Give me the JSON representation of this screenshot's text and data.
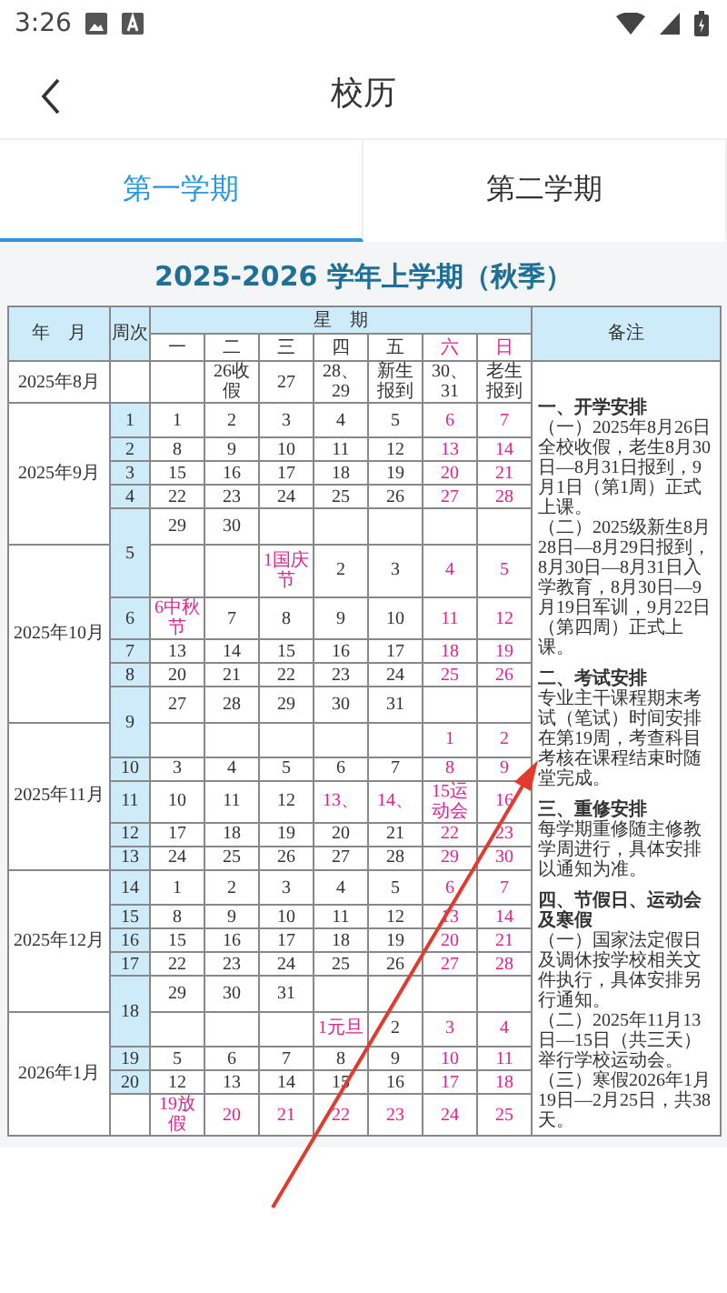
{
  "status_bar": {
    "time": "3:26"
  },
  "header": {
    "title": "校历"
  },
  "tabs": [
    {
      "label": "第一学期",
      "selected": true
    },
    {
      "label": "第二学期",
      "selected": false
    }
  ],
  "calendar": {
    "title": "2025-2026 学年上学期（秋季）",
    "columns": [
      "年　月",
      "周次",
      "星　期",
      "备注"
    ],
    "weekdays": [
      {
        "label": "一",
        "holiday": false
      },
      {
        "label": "二",
        "holiday": false
      },
      {
        "label": "三",
        "holiday": false
      },
      {
        "label": "四",
        "holiday": false
      },
      {
        "label": "五",
        "holiday": false
      },
      {
        "label": "六",
        "holiday": true
      },
      {
        "label": "日",
        "holiday": true
      }
    ],
    "rows": [
      {
        "kind": "no_week",
        "month": "2025年8月",
        "days": [
          {
            "kind": "blank"
          },
          {
            "kind": "day",
            "text": "26收假",
            "holiday": false
          },
          {
            "kind": "day",
            "text": "27",
            "holiday": false
          },
          {
            "kind": "day",
            "text": "28、29",
            "holiday": false
          },
          {
            "kind": "day",
            "text": "新生报到",
            "holiday": false
          },
          {
            "kind": "day",
            "text": "30、31",
            "holiday": false
          },
          {
            "kind": "day",
            "text": "老生报到",
            "holiday": false
          }
        ]
      },
      {
        "kind": "week_start",
        "month": "2025年9月",
        "week": "1",
        "days": [
          {
            "kind": "day",
            "text": "1",
            "holiday": false
          },
          {
            "kind": "day",
            "text": "2",
            "holiday": false
          },
          {
            "kind": "day",
            "text": "3",
            "holiday": false
          },
          {
            "kind": "day",
            "text": "4",
            "holiday": false
          },
          {
            "kind": "day",
            "text": "5",
            "holiday": false
          },
          {
            "kind": "day",
            "text": "6",
            "holiday": true
          },
          {
            "kind": "day",
            "text": "7",
            "holiday": true
          }
        ]
      },
      {
        "kind": "week_start",
        "week": "2",
        "days": [
          {
            "kind": "day",
            "text": "8",
            "holiday": false
          },
          {
            "kind": "day",
            "text": "9",
            "holiday": false
          },
          {
            "kind": "day",
            "text": "10",
            "holiday": false
          },
          {
            "kind": "day",
            "text": "11",
            "holiday": false
          },
          {
            "kind": "day",
            "text": "12",
            "holiday": false
          },
          {
            "kind": "day",
            "text": "13",
            "holiday": true
          },
          {
            "kind": "day",
            "text": "14",
            "holiday": true
          }
        ]
      },
      {
        "kind": "week_start",
        "week": "3",
        "days": [
          {
            "kind": "day",
            "text": "15",
            "holiday": false
          },
          {
            "kind": "day",
            "text": "16",
            "holiday": false
          },
          {
            "kind": "day",
            "text": "17",
            "holiday": false
          },
          {
            "kind": "day",
            "text": "18",
            "holiday": false
          },
          {
            "kind": "day",
            "text": "19",
            "holiday": false
          },
          {
            "kind": "day",
            "text": "20",
            "holiday": true
          },
          {
            "kind": "day",
            "text": "21",
            "holiday": true
          }
        ]
      },
      {
        "kind": "week_start",
        "week": "4",
        "days": [
          {
            "kind": "day",
            "text": "22",
            "holiday": false
          },
          {
            "kind": "day",
            "text": "23",
            "holiday": false
          },
          {
            "kind": "day",
            "text": "24",
            "holiday": false
          },
          {
            "kind": "day",
            "text": "25",
            "holiday": false
          },
          {
            "kind": "day",
            "text": "26",
            "holiday": false
          },
          {
            "kind": "day",
            "text": "27",
            "holiday": true
          },
          {
            "kind": "day",
            "text": "28",
            "holiday": true
          }
        ]
      },
      {
        "kind": "week_start",
        "week": "5",
        "days": [
          {
            "kind": "day",
            "text": "29",
            "holiday": false
          },
          {
            "kind": "day",
            "text": "30",
            "holiday": false
          },
          {
            "kind": "blank"
          },
          {
            "kind": "blank"
          },
          {
            "kind": "blank"
          },
          {
            "kind": "blank"
          },
          {
            "kind": "blank"
          }
        ]
      },
      {
        "kind": "week_continued",
        "month": "2025年10月",
        "days": [
          {
            "kind": "blank"
          },
          {
            "kind": "blank"
          },
          {
            "kind": "day",
            "text": "1国庆节",
            "holiday": true
          },
          {
            "kind": "day",
            "text": "2",
            "holiday": false
          },
          {
            "kind": "day",
            "text": "3",
            "holiday": false
          },
          {
            "kind": "day",
            "text": "4",
            "holiday": true
          },
          {
            "kind": "day",
            "text": "5",
            "holiday": true
          }
        ]
      },
      {
        "kind": "week_start",
        "week": "6",
        "days": [
          {
            "kind": "day",
            "text": "6中秋节",
            "holiday": true
          },
          {
            "kind": "day",
            "text": "7",
            "holiday": false
          },
          {
            "kind": "day",
            "text": "8",
            "holiday": false
          },
          {
            "kind": "day",
            "text": "9",
            "holiday": false
          },
          {
            "kind": "day",
            "text": "10",
            "holiday": false
          },
          {
            "kind": "day",
            "text": "11",
            "holiday": true
          },
          {
            "kind": "day",
            "text": "12",
            "holiday": true
          }
        ]
      },
      {
        "kind": "week_start",
        "week": "7",
        "days": [
          {
            "kind": "day",
            "text": "13",
            "holiday": false
          },
          {
            "kind": "day",
            "text": "14",
            "holiday": false
          },
          {
            "kind": "day",
            "text": "15",
            "holiday": false
          },
          {
            "kind": "day",
            "text": "16",
            "holiday": false
          },
          {
            "kind": "day",
            "text": "17",
            "holiday": false
          },
          {
            "kind": "day",
            "text": "18",
            "holiday": true
          },
          {
            "kind": "day",
            "text": "19",
            "holiday": true
          }
        ]
      },
      {
        "kind": "week_start",
        "week": "8",
        "days": [
          {
            "kind": "day",
            "text": "20",
            "holiday": false
          },
          {
            "kind": "day",
            "text": "21",
            "holiday": false
          },
          {
            "kind": "day",
            "text": "22",
            "holiday": false
          },
          {
            "kind": "day",
            "text": "23",
            "holiday": false
          },
          {
            "kind": "day",
            "text": "24",
            "holiday": false
          },
          {
            "kind": "day",
            "text": "25",
            "holiday": true
          },
          {
            "kind": "day",
            "text": "26",
            "holiday": true
          }
        ]
      },
      {
        "kind": "week_start",
        "week": "9",
        "days": [
          {
            "kind": "day",
            "text": "27",
            "holiday": false
          },
          {
            "kind": "day",
            "text": "28",
            "holiday": false
          },
          {
            "kind": "day",
            "text": "29",
            "holiday": false
          },
          {
            "kind": "day",
            "text": "30",
            "holiday": false
          },
          {
            "kind": "day",
            "text": "31",
            "holiday": false
          },
          {
            "kind": "blank"
          },
          {
            "kind": "blank"
          }
        ]
      },
      {
        "kind": "week_continued",
        "month": "2025年11月",
        "days": [
          {
            "kind": "blank"
          },
          {
            "kind": "blank"
          },
          {
            "kind": "blank"
          },
          {
            "kind": "blank"
          },
          {
            "kind": "blank"
          },
          {
            "kind": "day",
            "text": "1",
            "holiday": true
          },
          {
            "kind": "day",
            "text": "2",
            "holiday": true
          }
        ]
      },
      {
        "kind": "week_start",
        "week": "10",
        "days": [
          {
            "kind": "day",
            "text": "3",
            "holiday": false
          },
          {
            "kind": "day",
            "text": "4",
            "holiday": false
          },
          {
            "kind": "day",
            "text": "5",
            "holiday": false
          },
          {
            "kind": "day",
            "text": "6",
            "holiday": false
          },
          {
            "kind": "day",
            "text": "7",
            "holiday": false
          },
          {
            "kind": "day",
            "text": "8",
            "holiday": true
          },
          {
            "kind": "day",
            "text": "9",
            "holiday": true
          }
        ]
      },
      {
        "kind": "week_start",
        "week": "11",
        "days": [
          {
            "kind": "day",
            "text": "10",
            "holiday": false
          },
          {
            "kind": "day",
            "text": "11",
            "holiday": false
          },
          {
            "kind": "day",
            "text": "12",
            "holiday": false
          },
          {
            "kind": "day",
            "text": "13、",
            "holiday": true
          },
          {
            "kind": "day",
            "text": "14、",
            "holiday": true
          },
          {
            "kind": "day",
            "text": "15运动会",
            "holiday": true
          },
          {
            "kind": "day",
            "text": "16",
            "holiday": true
          }
        ]
      },
      {
        "kind": "week_start",
        "week": "12",
        "days": [
          {
            "kind": "day",
            "text": "17",
            "holiday": false
          },
          {
            "kind": "day",
            "text": "18",
            "holiday": false
          },
          {
            "kind": "day",
            "text": "19",
            "holiday": false
          },
          {
            "kind": "day",
            "text": "20",
            "holiday": false
          },
          {
            "kind": "day",
            "text": "21",
            "holiday": false
          },
          {
            "kind": "day",
            "text": "22",
            "holiday": true
          },
          {
            "kind": "day",
            "text": "23",
            "holiday": true
          }
        ]
      },
      {
        "kind": "week_start",
        "week": "13",
        "days": [
          {
            "kind": "day",
            "text": "24",
            "holiday": false
          },
          {
            "kind": "day",
            "text": "25",
            "holiday": false
          },
          {
            "kind": "day",
            "text": "26",
            "holiday": false
          },
          {
            "kind": "day",
            "text": "27",
            "holiday": false
          },
          {
            "kind": "day",
            "text": "28",
            "holiday": false
          },
          {
            "kind": "day",
            "text": "29",
            "holiday": true
          },
          {
            "kind": "day",
            "text": "30",
            "holiday": true
          }
        ]
      },
      {
        "kind": "week_start",
        "month": "2025年12月",
        "week": "14",
        "days": [
          {
            "kind": "day",
            "text": "1",
            "holiday": false
          },
          {
            "kind": "day",
            "text": "2",
            "holiday": false
          },
          {
            "kind": "day",
            "text": "3",
            "holiday": false
          },
          {
            "kind": "day",
            "text": "4",
            "holiday": false
          },
          {
            "kind": "day",
            "text": "5",
            "holiday": false
          },
          {
            "kind": "day",
            "text": "6",
            "holiday": true
          },
          {
            "kind": "day",
            "text": "7",
            "holiday": true
          }
        ]
      },
      {
        "kind": "week_start",
        "week": "15",
        "days": [
          {
            "kind": "day",
            "text": "8",
            "holiday": false
          },
          {
            "kind": "day",
            "text": "9",
            "holiday": false
          },
          {
            "kind": "day",
            "text": "10",
            "holiday": false
          },
          {
            "kind": "day",
            "text": "11",
            "holiday": false
          },
          {
            "kind": "day",
            "text": "12",
            "holiday": false
          },
          {
            "kind": "day",
            "text": "13",
            "holiday": true
          },
          {
            "kind": "day",
            "text": "14",
            "holiday": true
          }
        ]
      },
      {
        "kind": "week_start",
        "week": "16",
        "days": [
          {
            "kind": "day",
            "text": "15",
            "holiday": false
          },
          {
            "kind": "day",
            "text": "16",
            "holiday": false
          },
          {
            "kind": "day",
            "text": "17",
            "holiday": false
          },
          {
            "kind": "day",
            "text": "18",
            "holiday": false
          },
          {
            "kind": "day",
            "text": "19",
            "holiday": false
          },
          {
            "kind": "day",
            "text": "20",
            "holiday": true
          },
          {
            "kind": "day",
            "text": "21",
            "holiday": true
          }
        ]
      },
      {
        "kind": "week_start",
        "week": "17",
        "days": [
          {
            "kind": "day",
            "text": "22",
            "holiday": false
          },
          {
            "kind": "day",
            "text": "23",
            "holiday": false
          },
          {
            "kind": "day",
            "text": "24",
            "holiday": false
          },
          {
            "kind": "day",
            "text": "25",
            "holiday": false
          },
          {
            "kind": "day",
            "text": "26",
            "holiday": false
          },
          {
            "kind": "day",
            "text": "27",
            "holiday": true
          },
          {
            "kind": "day",
            "text": "28",
            "holiday": true
          }
        ]
      },
      {
        "kind": "week_start",
        "week": "18",
        "days": [
          {
            "kind": "day",
            "text": "29",
            "holiday": false
          },
          {
            "kind": "day",
            "text": "30",
            "holiday": false
          },
          {
            "kind": "day",
            "text": "31",
            "holiday": false
          },
          {
            "kind": "blank"
          },
          {
            "kind": "blank"
          },
          {
            "kind": "blank"
          },
          {
            "kind": "blank"
          }
        ]
      },
      {
        "kind": "week_continued",
        "month": "2026年1月",
        "days": [
          {
            "kind": "blank"
          },
          {
            "kind": "blank"
          },
          {
            "kind": "blank"
          },
          {
            "kind": "day",
            "text": "1元旦",
            "holiday": true
          },
          {
            "kind": "day",
            "text": "2",
            "holiday": false
          },
          {
            "kind": "day",
            "text": "3",
            "holiday": true
          },
          {
            "kind": "day",
            "text": "4",
            "holiday": true
          }
        ]
      },
      {
        "kind": "week_start",
        "week": "19",
        "days": [
          {
            "kind": "day",
            "text": "5",
            "holiday": false
          },
          {
            "kind": "day",
            "text": "6",
            "holiday": false
          },
          {
            "kind": "day",
            "text": "7",
            "holiday": false
          },
          {
            "kind": "day",
            "text": "8",
            "holiday": false
          },
          {
            "kind": "day",
            "text": "9",
            "holiday": false
          },
          {
            "kind": "day",
            "text": "10",
            "holiday": true
          },
          {
            "kind": "day",
            "text": "11",
            "holiday": true
          }
        ]
      },
      {
        "kind": "week_start",
        "week": "20",
        "days": [
          {
            "kind": "day",
            "text": "12",
            "holiday": false
          },
          {
            "kind": "day",
            "text": "13",
            "holiday": false
          },
          {
            "kind": "day",
            "text": "14",
            "holiday": false
          },
          {
            "kind": "day",
            "text": "15",
            "holiday": false
          },
          {
            "kind": "day",
            "text": "16",
            "holiday": false
          },
          {
            "kind": "day",
            "text": "17",
            "holiday": true
          },
          {
            "kind": "day",
            "text": "18",
            "holiday": true
          }
        ]
      },
      {
        "kind": "no_week",
        "days": [
          {
            "kind": "day",
            "text": "19放假",
            "holiday": true
          },
          {
            "kind": "day",
            "text": "20",
            "holiday": true
          },
          {
            "kind": "day",
            "text": "21",
            "holiday": true
          },
          {
            "kind": "day",
            "text": "22",
            "holiday": true
          },
          {
            "kind": "day",
            "text": "23",
            "holiday": true
          },
          {
            "kind": "day",
            "text": "24",
            "holiday": true
          },
          {
            "kind": "day",
            "text": "25",
            "holiday": true
          }
        ]
      }
    ],
    "notes": [
      {
        "kind": "heading",
        "text": "一、开学安排"
      },
      {
        "kind": "text",
        "text": "（一）2025年8月26日全校收假，老生8月30日—8月31日报到，9月1日（第1周）正式上课。"
      },
      {
        "kind": "text",
        "text": "（二）2025级新生8月28日—8月29日报到，8月30日—8月31日入学教育，8月30日—9月19日军训，9月22日（第四周）正式上课。"
      },
      {
        "kind": "heading",
        "text": "二、考试安排"
      },
      {
        "kind": "text",
        "text": "专业主干课程期末考试（笔试）时间安排在第19周，考查科目考核在课程结束时随堂完成。"
      },
      {
        "kind": "heading",
        "text": "三、重修安排"
      },
      {
        "kind": "text",
        "text": "每学期重修随主修教学周进行，具体安排以通知为准。"
      },
      {
        "kind": "heading",
        "text": "四、节假日、运动会及寒假"
      },
      {
        "kind": "text",
        "text": "（一）国家法定假日及调休按学校相关文件执行，具体安排另行通知。"
      },
      {
        "kind": "text",
        "text": "（二）2025年11月13日—15日（共三天）举行学校运动会。"
      },
      {
        "kind": "text",
        "text": "（三）寒假2026年1月19日—2月25日，共38天。"
      }
    ]
  }
}
